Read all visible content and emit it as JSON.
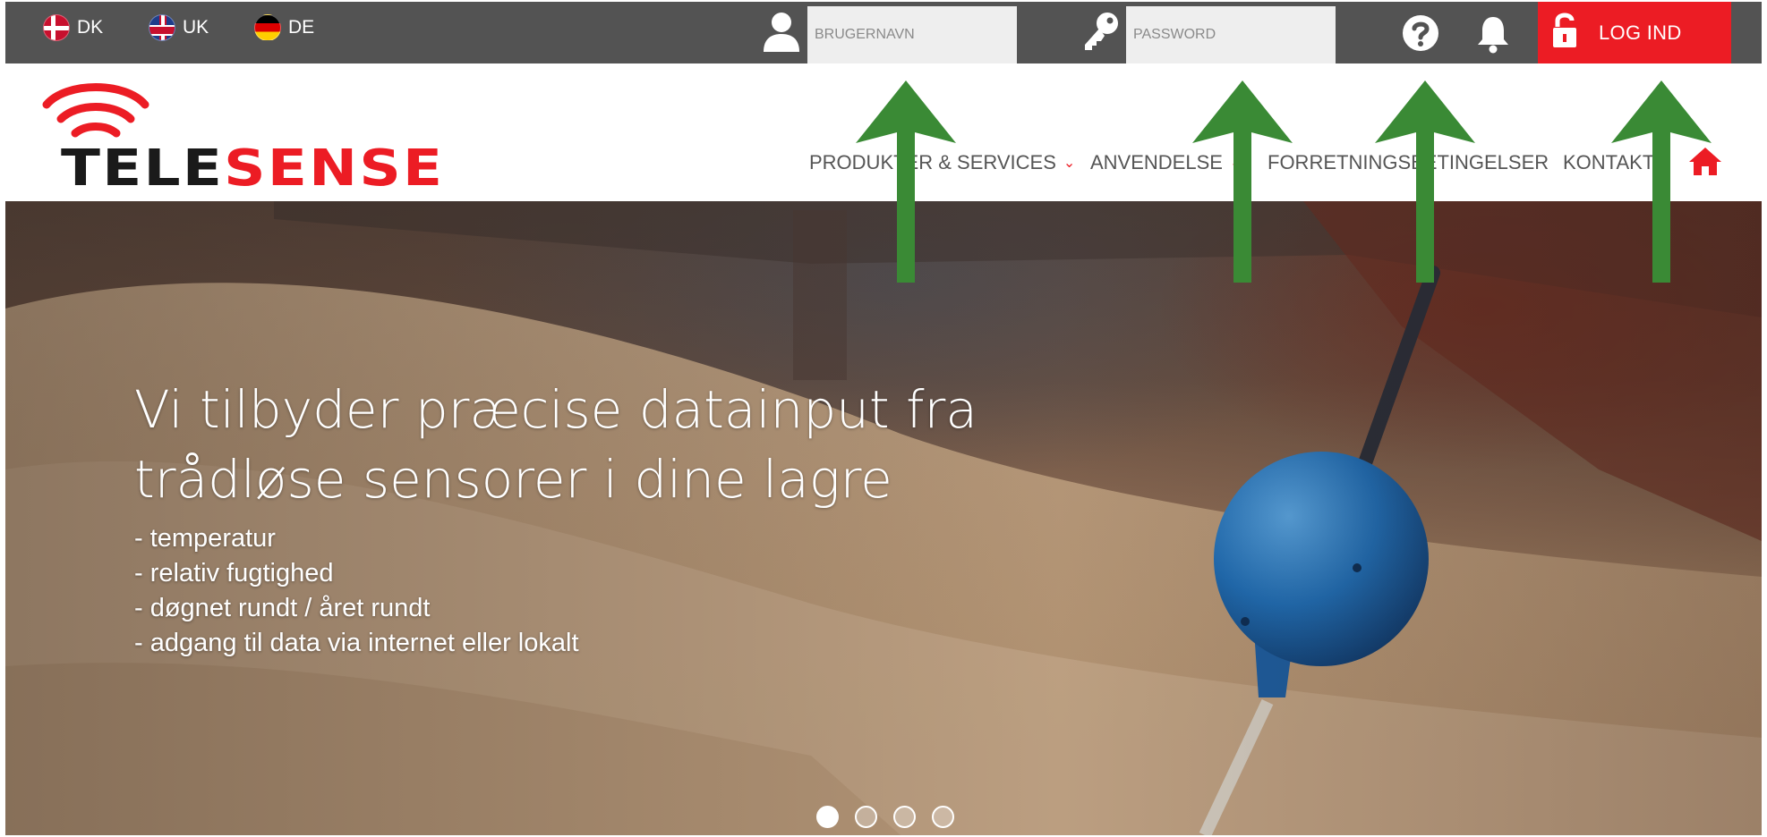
{
  "topbar": {
    "languages": [
      {
        "code": "DK",
        "flag": "denmark-flag-icon"
      },
      {
        "code": "UK",
        "flag": "uk-flag-icon"
      },
      {
        "code": "DE",
        "flag": "germany-flag-icon"
      }
    ],
    "username_placeholder": "BRUGERNAVN",
    "password_placeholder": "PASSWORD",
    "login_label": "LOG IND",
    "colors": {
      "bar": "#535353",
      "login": "#ec1c24"
    }
  },
  "logo": {
    "part1": "TELE",
    "part2": "SENSE"
  },
  "nav": {
    "items": [
      {
        "label": "PRODUKTER & SERVICES",
        "has_dropdown": true
      },
      {
        "label": "ANVENDELSE",
        "has_dropdown": true
      },
      {
        "label": "FORRETNINGSBETINGELSER",
        "has_dropdown": false
      },
      {
        "label": "KONTAKT",
        "has_dropdown": false
      }
    ],
    "chevron": "⌄",
    "accent": "#ec1c24"
  },
  "hero": {
    "headline_line1": "Vi tilbyder præcise datainput fra",
    "headline_line2": "trådløse sensorer i dine lagre",
    "bullets": [
      "- temperatur",
      "- relativ fugtighed",
      "- døgnet rundt / året rundt",
      "- adgang til data via internet eller lokalt"
    ],
    "slides_total": 4,
    "active_slide": 1
  },
  "annotation": {
    "arrow_color": "#3a8a35",
    "arrow_count": 4
  }
}
